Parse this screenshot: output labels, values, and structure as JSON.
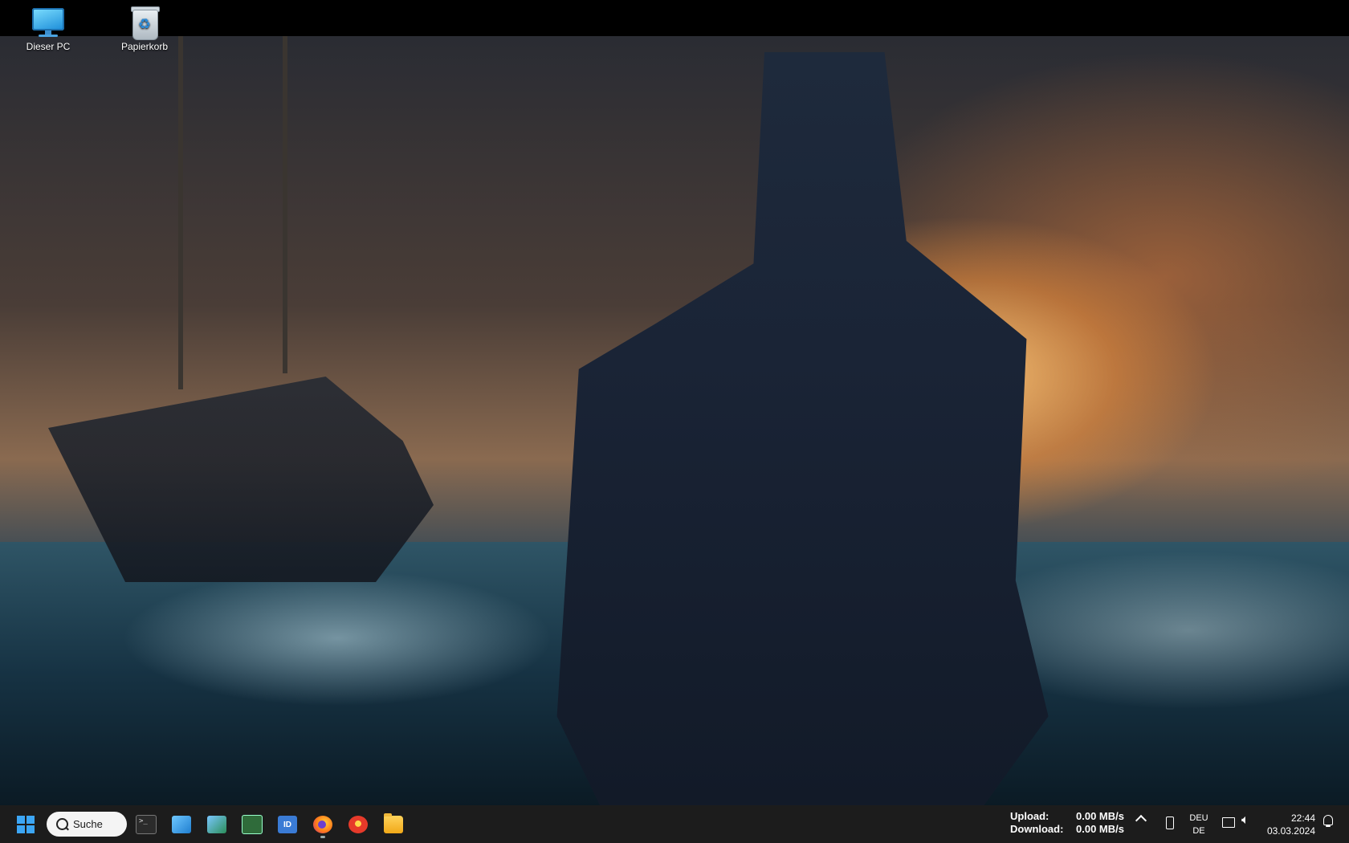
{
  "desktop": {
    "icons": [
      {
        "label": "Dieser PC",
        "icon": "monitor-icon"
      },
      {
        "label": "Papierkorb",
        "icon": "recycle-bin-icon"
      }
    ]
  },
  "taskbar": {
    "search_label": "Suche",
    "apps": [
      {
        "name": "terminal",
        "icon": "terminal-icon"
      },
      {
        "name": "window-app",
        "icon": "window-app-icon"
      },
      {
        "name": "control-panel",
        "icon": "control-panel-icon"
      },
      {
        "name": "circuit-board",
        "icon": "circuit-board-icon"
      },
      {
        "name": "id-app",
        "icon": "id-app-icon",
        "label": "ID"
      },
      {
        "name": "firefox",
        "icon": "firefox-icon"
      },
      {
        "name": "red-app",
        "icon": "red-circle-app-icon"
      },
      {
        "name": "file-explorer",
        "icon": "folder-icon"
      }
    ],
    "network": {
      "upload_label": "Upload:",
      "upload_value": "0.00 MB/s",
      "download_label": "Download:",
      "download_value": "0.00 MB/s"
    },
    "language": {
      "line1": "DEU",
      "line2": "DE"
    },
    "clock": {
      "time": "22:44",
      "date": "03.03.2024"
    }
  },
  "colors": {
    "taskbar": "#1c1c1c",
    "accent": "#3ca6f5"
  }
}
